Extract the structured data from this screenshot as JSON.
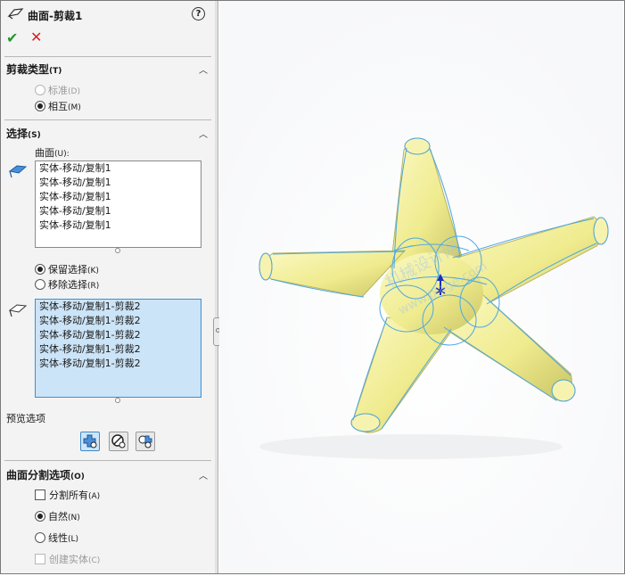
{
  "panel": {
    "title": "曲面-剪裁1",
    "help_label": "?",
    "ok_icon": "checkmark-icon",
    "cancel_icon": "close-icon"
  },
  "trim_type": {
    "header": "剪裁类型",
    "header_key": "(T)",
    "options": [
      {
        "label": "标准",
        "key": "(D)",
        "selected": false,
        "disabled": true
      },
      {
        "label": "相互",
        "key": "(M)",
        "selected": true,
        "disabled": false
      }
    ]
  },
  "selection": {
    "header": "选择",
    "header_key": "(S)",
    "surfaces_label": "曲面",
    "surfaces_key": "(U):",
    "surfaces": [
      "实体-移动/复制1",
      "实体-移动/复制1",
      "实体-移动/复制1",
      "实体-移动/复制1",
      "实体-移动/复制1"
    ],
    "keep_option": {
      "label": "保留选择",
      "key": "(K)",
      "selected": true
    },
    "remove_option": {
      "label": "移除选择",
      "key": "(R)",
      "selected": false
    },
    "pieces": [
      "实体-移动/复制1-剪裁2",
      "实体-移动/复制1-剪裁2",
      "实体-移动/复制1-剪裁2",
      "实体-移动/复制1-剪裁2",
      "实体-移动/复制1-剪裁2"
    ]
  },
  "preview": {
    "header": "预览选项"
  },
  "split": {
    "header": "曲面分割选项",
    "header_key": "(O)",
    "split_all": {
      "label": "分割所有",
      "key": "(A)",
      "checked": false
    },
    "natural": {
      "label": "自然",
      "key": "(N)",
      "selected": true
    },
    "linear": {
      "label": "线性",
      "key": "(L)",
      "selected": false
    },
    "create_solid": {
      "label": "创建实体",
      "key": "(C)",
      "checked": false,
      "disabled": true
    }
  },
  "watermark": {
    "line1": "机械设计网",
    "line2": "www.jxage.com"
  },
  "colors": {
    "surface": "#f2ef9a",
    "edge": "#4fa7e0",
    "selection": "#cce4f7"
  }
}
